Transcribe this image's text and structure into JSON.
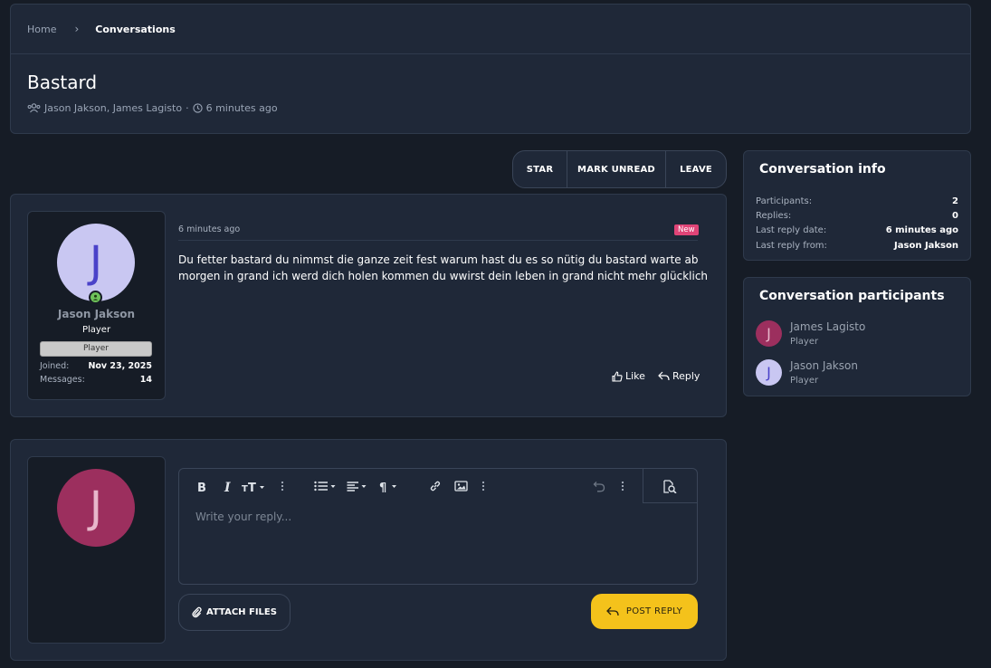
{
  "breadcrumb": {
    "home": "Home",
    "separator": "›",
    "current": "Conversations"
  },
  "conversation": {
    "title": "Bastard",
    "participants_text": "Jason Jakson, James Lagisto",
    "meta_separator": "·",
    "time": "6 minutes ago"
  },
  "actions": {
    "star": "STAR",
    "mark_unread": "MARK UNREAD",
    "leave": "LEAVE"
  },
  "message": {
    "author": {
      "initial": "J",
      "name": "Jason Jakson",
      "title": "Player",
      "banner": "Player",
      "joined_label": "Joined:",
      "joined_value": "Nov 23, 2025",
      "messages_label": "Messages:",
      "messages_value": "14"
    },
    "date": "6 minutes ago",
    "badge": "New",
    "body": "Du fetter bastard du nimmst die ganze zeit fest warum hast du es so nütig du bastard warte ab morgen in grand ich werd dich holen kommen du wwirst dein leben in grand nicht mehr glücklich",
    "like_label": "Like",
    "reply_label": "Reply"
  },
  "reply": {
    "avatar_initial": "J",
    "placeholder": "Write your reply...",
    "attach_label": "ATTACH FILES",
    "post_label": "POST REPLY"
  },
  "info": {
    "title": "Conversation info",
    "rows": [
      {
        "label": "Participants:",
        "value": "2"
      },
      {
        "label": "Replies:",
        "value": "0"
      },
      {
        "label": "Last reply date:",
        "value": "6 minutes ago"
      },
      {
        "label": "Last reply from:",
        "value": "Jason Jakson"
      }
    ]
  },
  "participants": {
    "title": "Conversation participants",
    "list": [
      {
        "initial": "J",
        "name": "James Lagisto",
        "role": "Player"
      },
      {
        "initial": "J",
        "name": "Jason Jakson",
        "role": "Player"
      }
    ]
  },
  "colors": {
    "background": "#161c26",
    "panel": "#1f2838",
    "accent_button": "#f4c21b",
    "new_badge": "#e04477",
    "online": "#6ec25a",
    "avatar_jason": "#c9c7f2",
    "avatar_james": "#9c2f5e"
  },
  "icons": [
    "users-icon",
    "clock-icon",
    "user-icon",
    "thumbs-up-icon",
    "reply-icon",
    "bold-icon",
    "italic-icon",
    "font-size-icon",
    "more-icon",
    "list-icon",
    "align-icon",
    "paragraph-icon",
    "link-icon",
    "image-icon",
    "undo-icon",
    "preview-icon",
    "paperclip-icon"
  ]
}
